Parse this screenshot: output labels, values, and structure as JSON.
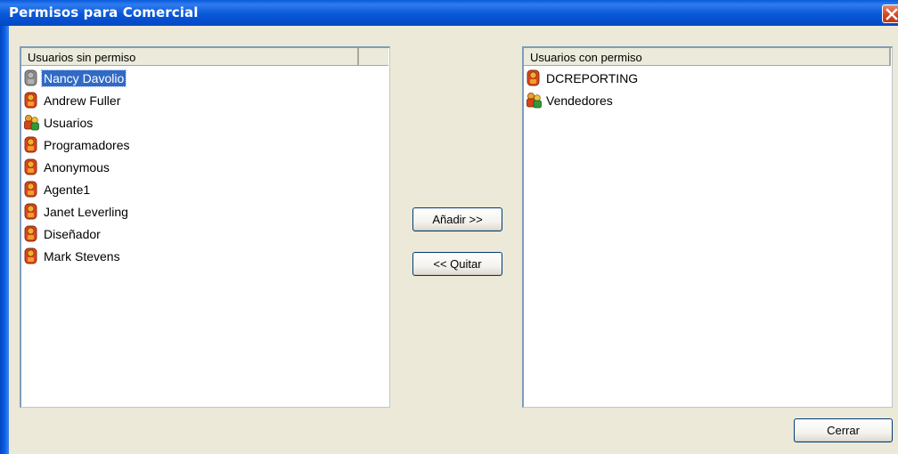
{
  "window": {
    "title": "Permisos para Comercial"
  },
  "left_list": {
    "header": "Usuarios sin permiso",
    "items": [
      {
        "label": "Nancy Davolio",
        "icon": "user-gray-icon",
        "selected": true
      },
      {
        "label": "Andrew Fuller",
        "icon": "user-icon"
      },
      {
        "label": "Usuarios",
        "icon": "group-icon"
      },
      {
        "label": "Programadores",
        "icon": "user-icon"
      },
      {
        "label": "Anonymous",
        "icon": "user-icon"
      },
      {
        "label": "Agente1",
        "icon": "user-icon"
      },
      {
        "label": "Janet Leverling",
        "icon": "user-icon"
      },
      {
        "label": "Diseñador",
        "icon": "user-icon"
      },
      {
        "label": "Mark Stevens",
        "icon": "user-icon"
      }
    ]
  },
  "right_list": {
    "header": "Usuarios con permiso",
    "items": [
      {
        "label": "DCREPORTING",
        "icon": "user-icon"
      },
      {
        "label": "Vendedores",
        "icon": "group-icon"
      }
    ]
  },
  "buttons": {
    "add": "Añadir >>",
    "remove": "<< Quitar",
    "close": "Cerrar"
  },
  "colors": {
    "title_bar": "#0857d8",
    "selection": "#316ac5",
    "dialog_bg": "#ece9d8"
  }
}
